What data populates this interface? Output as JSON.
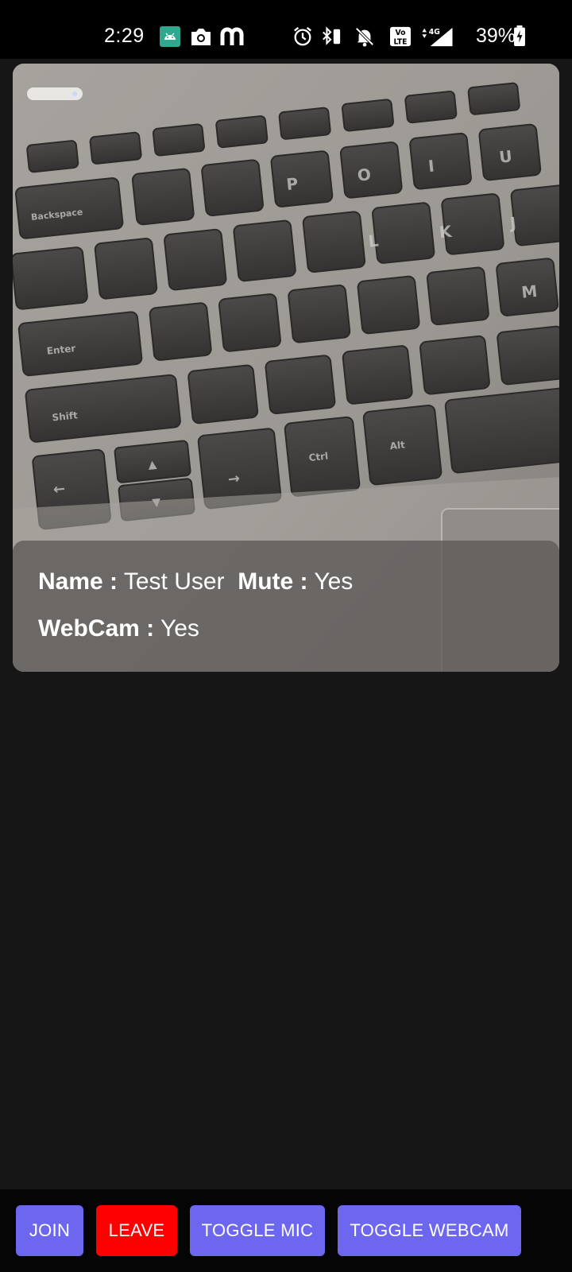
{
  "status_bar": {
    "time": "2:29",
    "battery_percent": "39%",
    "network_badge": "4G",
    "volte_badge_line1": "Vo",
    "volte_badge_line2": "LTE",
    "left_icons": [
      "android-icon",
      "camera-icon",
      "m-app-icon"
    ],
    "right_icons": [
      "alarm-icon",
      "bluetooth-icon",
      "silent-icon",
      "volte-icon",
      "signal-4g-icon",
      "battery-charging-icon"
    ]
  },
  "video_tile": {
    "name_label": "Name :",
    "name_value": "Test User",
    "mute_label": "Mute :",
    "mute_value": "Yes",
    "webcam_label": "WebCam :",
    "webcam_value": "Yes"
  },
  "controls": {
    "join_label": "JOIN",
    "leave_label": "LEAVE",
    "toggle_mic_label": "TOGGLE MIC",
    "toggle_webcam_label": "TOGGLE WEBCAM"
  },
  "colors": {
    "accent": "#6d67f0",
    "leave": "#ff0000",
    "background": "#161616"
  }
}
